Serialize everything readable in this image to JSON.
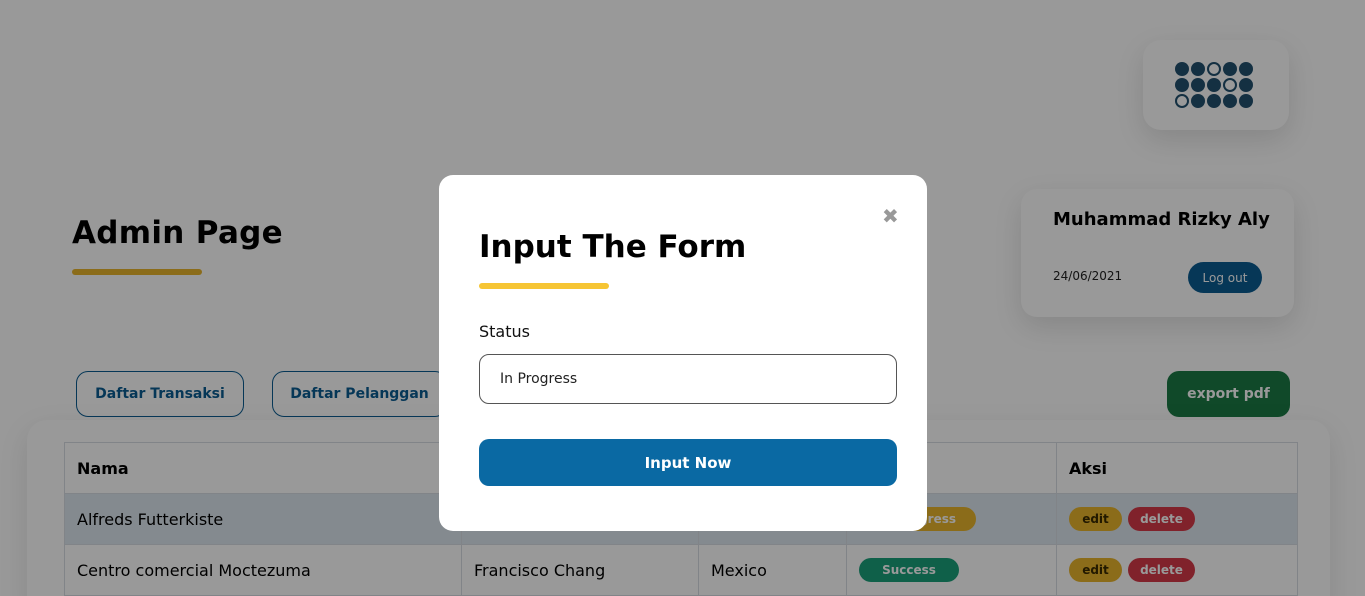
{
  "page": {
    "title": "Admin Page"
  },
  "logo": {
    "icon": "dots-grid-logo",
    "pattern": [
      [
        1,
        1,
        0,
        1,
        1
      ],
      [
        1,
        1,
        1,
        0,
        1
      ],
      [
        0,
        1,
        1,
        1,
        1
      ]
    ]
  },
  "user": {
    "name": "Muhammad Rizky Aly",
    "date": "24/06/2021",
    "logout_label": "Log out"
  },
  "tabs": [
    {
      "label": "Daftar Transaksi"
    },
    {
      "label": "Daftar Pelanggan"
    }
  ],
  "export_label": "export pdf",
  "table": {
    "headers": [
      "Nama",
      "",
      "",
      "",
      "Aksi"
    ],
    "rows": [
      {
        "cells": [
          "Alfreds Futterkiste",
          "",
          "",
          ""
        ],
        "status": "In Progress",
        "status_type": "progress",
        "edit": "edit",
        "delete": "delete"
      },
      {
        "cells": [
          "Centro comercial Moctezuma",
          "Francisco Chang",
          "Mexico",
          ""
        ],
        "status": "Success",
        "status_type": "success",
        "edit": "edit",
        "delete": "delete"
      }
    ]
  },
  "modal": {
    "title": "Input The Form",
    "close_icon": "close-icon",
    "status_label": "Status",
    "status_value": "In Progress",
    "submit_label": "Input Now"
  },
  "colors": {
    "primary": "#0a69a3",
    "accent": "#f6c534",
    "success": "#1aa07a",
    "danger": "#d63a48",
    "export": "#1b7a45"
  }
}
